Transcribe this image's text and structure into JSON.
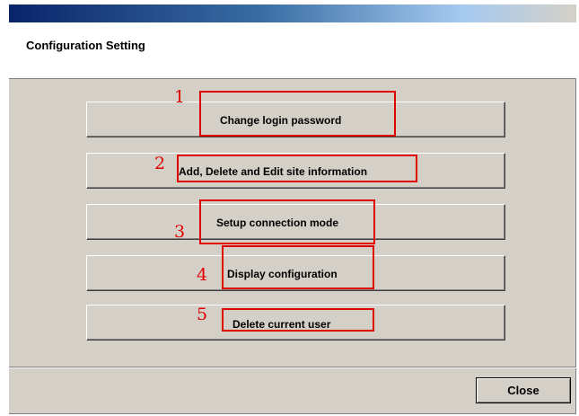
{
  "window": {
    "header_title": "Configuration Setting"
  },
  "options": [
    {
      "number": "1",
      "label": "Change login password"
    },
    {
      "number": "2",
      "label": "Add, Delete and Edit site information"
    },
    {
      "number": "3",
      "label": "Setup connection mode"
    },
    {
      "number": "4",
      "label": "Display configuration"
    },
    {
      "number": "5",
      "label": "Delete current user"
    }
  ],
  "footer": {
    "close_label": "Close"
  },
  "colors": {
    "highlight": "#e00000",
    "dialog_bg": "#d4d0c8",
    "titlebar": "#0a246a"
  }
}
